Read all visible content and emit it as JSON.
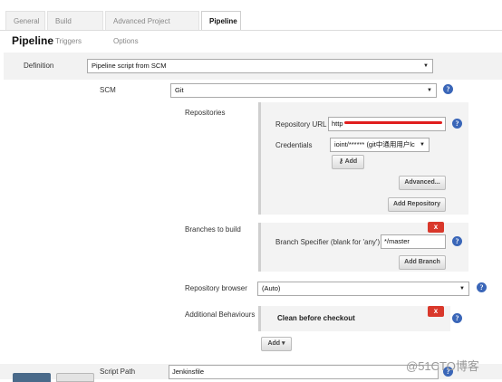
{
  "tabs": [
    {
      "label": "General"
    },
    {
      "label": "Build Triggers"
    },
    {
      "label": "Advanced Project Options"
    },
    {
      "label": "Pipeline"
    }
  ],
  "page_title": "Pipeline",
  "definition": {
    "label": "Definition",
    "value": "Pipeline script from SCM"
  },
  "scm": {
    "label": "SCM",
    "value": "Git"
  },
  "repositories": {
    "label": "Repositories",
    "url_label": "Repository URL",
    "url_value": "http",
    "credentials_label": "Credentials",
    "credentials_value": "ioint/****** (git中通用用户lc",
    "add_label": "Add",
    "advanced_label": "Advanced...",
    "add_repository_label": "Add Repository"
  },
  "branches": {
    "label": "Branches to build",
    "x_label": "x",
    "specifier_label": "Branch Specifier (blank for 'any')",
    "specifier_value": "*/master",
    "add_branch_label": "Add Branch"
  },
  "repo_browser": {
    "label": "Repository browser",
    "value": "(Auto)"
  },
  "behaviours": {
    "label": "Additional Behaviours",
    "x_label": "x",
    "item_label": "Clean before checkout",
    "add_label": "Add"
  },
  "script_path": {
    "label": "Script Path",
    "value": "Jenkinsfile"
  },
  "watermark": "@51CTO博客",
  "colors": {
    "help": "#3a66b8",
    "x_button": "#d9382b",
    "redaction": "#e01e1e",
    "panel": "#f3f3f3"
  }
}
